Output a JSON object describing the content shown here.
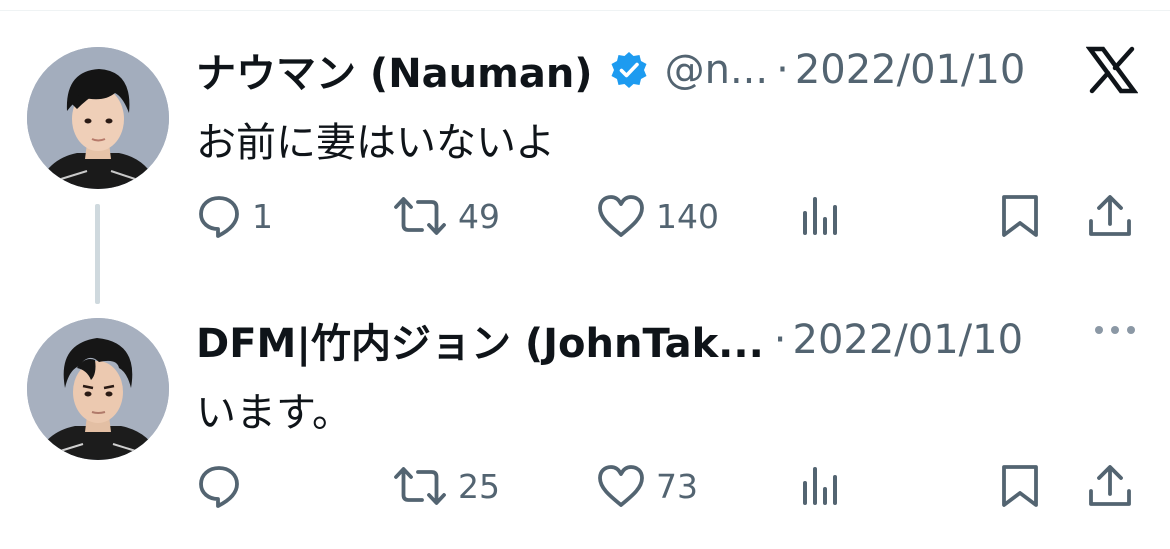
{
  "tweets": [
    {
      "name": "ナウマン (Nauman)",
      "verified": true,
      "handle": "@n...",
      "separator": "·",
      "date": "2022/01/10",
      "text": "お前に妻はいないよ",
      "replies": "1",
      "retweets": "49",
      "likes": "140"
    },
    {
      "name": "DFM|竹内ジョン (JohnTak...",
      "separator": "·",
      "date": "2022/01/10",
      "text": "います。",
      "replies": "",
      "retweets": "25",
      "likes": "73"
    }
  ],
  "icons": {
    "brand": "x-logo-icon",
    "more": "more-dots-icon",
    "reply": "reply-icon",
    "retweet": "retweet-icon",
    "like": "heart-icon",
    "views": "analytics-icon",
    "bookmark": "bookmark-icon",
    "share": "share-icon"
  },
  "colors": {
    "text": "#0f1419",
    "secondary": "#536471",
    "verified": "#1d9bf0",
    "thread_line": "#cfd9de"
  }
}
